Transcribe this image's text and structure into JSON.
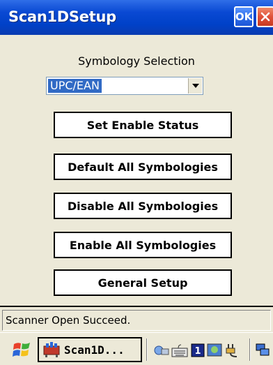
{
  "window": {
    "title": "Scan1DSetup",
    "ok_label": "OK"
  },
  "symbology": {
    "label": "Symbology Selection",
    "selected": "UPC/EAN"
  },
  "buttons": {
    "set_enable_status": "Set Enable Status",
    "default_all": "Default All Symbologies",
    "disable_all": "Disable All Symbologies",
    "enable_all": "Enable All Symbologies",
    "general_setup": "General Setup"
  },
  "status": {
    "text": "Scanner Open Succeed."
  },
  "taskbar": {
    "task_label": "Scan1D...",
    "tray_icons": [
      "network-icon",
      "keyboard-icon",
      "input-panel-1-icon",
      "display-icon",
      "power-plug-icon",
      "windows-switch-icon"
    ]
  },
  "colors": {
    "titlebar": "#0a49d3",
    "selection": "#316ac5",
    "close": "#e0503a",
    "background": "#ece9d8"
  }
}
